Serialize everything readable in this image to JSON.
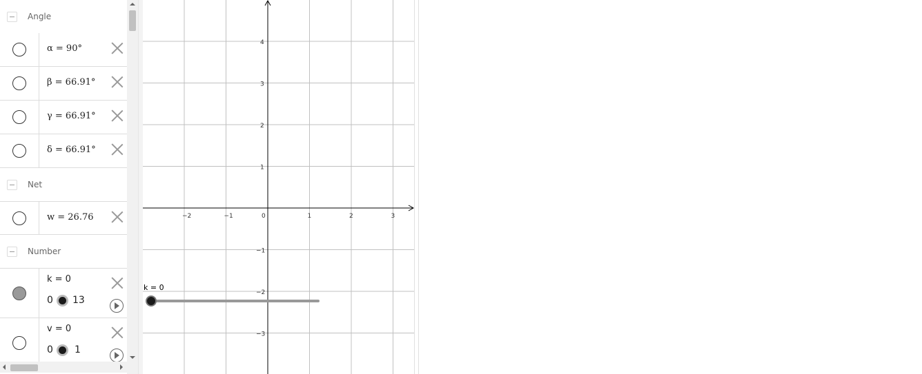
{
  "algebra": {
    "groups": [
      {
        "title": "Angle",
        "items": [
          {
            "formula": "α = 90°"
          },
          {
            "formula": "β = 66.91°"
          },
          {
            "formula": "γ = 66.91°"
          },
          {
            "formula": "δ = 66.91°"
          }
        ]
      },
      {
        "title": "Net",
        "items": [
          {
            "formula": "w = 26.76"
          }
        ]
      },
      {
        "title": "Number",
        "items": [
          {
            "formula": "k = 0",
            "slider_min": "0",
            "slider_max": "13",
            "visible": true
          },
          {
            "formula": "v = 0",
            "slider_min": "0",
            "slider_max": "1",
            "visible": false
          }
        ]
      }
    ]
  },
  "graphics": {
    "x_ticks": [
      "−2",
      "−1",
      "0",
      "1",
      "2",
      "3"
    ],
    "y_ticks": [
      "4",
      "3",
      "2",
      "1",
      "−1",
      "−2",
      "−3"
    ],
    "slider_label": "k = 0",
    "slider_value": 0
  },
  "colors": {
    "grid": "#c0c0c0",
    "axis": "#000000",
    "border": "#dcdcdc"
  }
}
